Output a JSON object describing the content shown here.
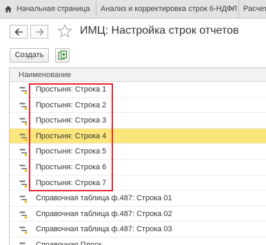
{
  "tabs": [
    {
      "label": "Начальная страница"
    },
    {
      "label": "Анализ и корректировка строк 6-НДФЛ",
      "close": "×"
    },
    {
      "label": "Расчет"
    }
  ],
  "header": {
    "title": "ИМЦ: Настройка строк отчетов"
  },
  "toolbar": {
    "create_label": "Создать"
  },
  "table": {
    "column_name": "Наименование",
    "rows": [
      {
        "text": "Простыня: Строка 1",
        "selected": false
      },
      {
        "text": "Простыня: Строка 2",
        "selected": false
      },
      {
        "text": "Простыня: Строка 3",
        "selected": false
      },
      {
        "text": "Простыня: Строка 4",
        "selected": true
      },
      {
        "text": "Простыня: Строка 5",
        "selected": false
      },
      {
        "text": "Простыня: Строка 6",
        "selected": false
      },
      {
        "text": "Простыня: Строка 7",
        "selected": false
      },
      {
        "text": "Справочная таблица ф.487: Строка 01",
        "selected": false
      },
      {
        "text": "Справочная таблица ф.487: Строка 02",
        "selected": false
      },
      {
        "text": "Справочная таблица ф.487: Строка 03",
        "selected": false
      },
      {
        "text": "Справочная Плоск",
        "selected": false
      }
    ]
  },
  "colors": {
    "selected_row": "#fbe67b",
    "highlight_border": "#e8202a"
  },
  "icons": [
    "home-icon",
    "back-arrow-icon",
    "forward-arrow-icon",
    "star-icon",
    "copy-icon",
    "row-item-icon"
  ]
}
